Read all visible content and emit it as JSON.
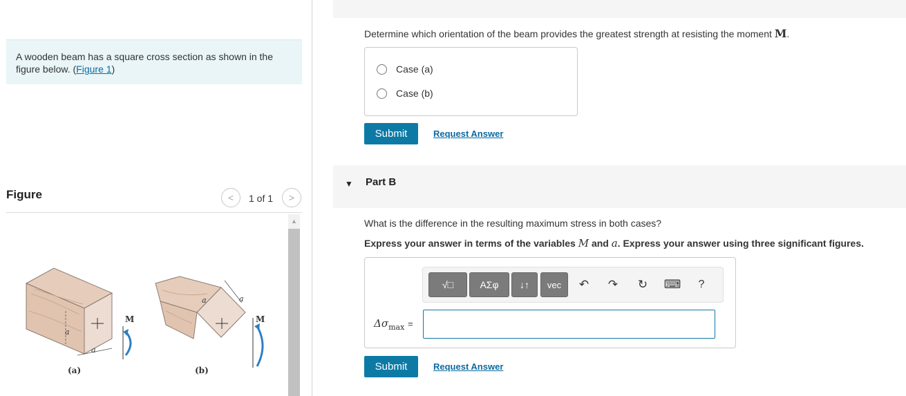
{
  "problem": {
    "text": "A wooden beam has a square cross section as shown in the figure below.",
    "figure_link": "Figure 1",
    "paren_open": "(",
    "paren_close": ")"
  },
  "figure": {
    "title": "Figure",
    "pager": "1 of 1",
    "caption_a": "(a)",
    "caption_b": "(b)",
    "label_a": "a",
    "label_M": "M"
  },
  "part_a": {
    "question": "Determine which orientation of the beam provides the greatest strength at resisting the moment",
    "question_symbol": "M",
    "question_end": ".",
    "options": [
      "Case (a)",
      "Case (b)"
    ],
    "submit": "Submit",
    "request": "Request Answer"
  },
  "part_b": {
    "title": "Part B",
    "question": "What is the difference in the resulting maximum stress in both cases?",
    "instruct_1": "Express your answer in terms of the variables",
    "var_M": "M",
    "instruct_and": "and",
    "var_a": "a",
    "instruct_2": ". Express your answer using three significant figures.",
    "answer_label": "Δσ",
    "answer_sub": "max",
    "answer_eq": "=",
    "answer_value": "",
    "submit": "Submit",
    "request": "Request Answer",
    "toolbar": {
      "templates": "√□",
      "greek": "ΑΣφ",
      "arrows": "↓↑",
      "vec": "vec",
      "help": "?"
    }
  },
  "icons": {
    "caret": "▼",
    "prev": "<",
    "next": ">",
    "undo": "↶",
    "redo": "↷",
    "reset": "↻",
    "keyboard": "⌨",
    "scroll_up": "▲"
  },
  "colors": {
    "accent": "#0d7aa6",
    "link": "#0b6aa2",
    "problem_bg": "#e9f5f7",
    "wood": "#e3c9b6"
  }
}
